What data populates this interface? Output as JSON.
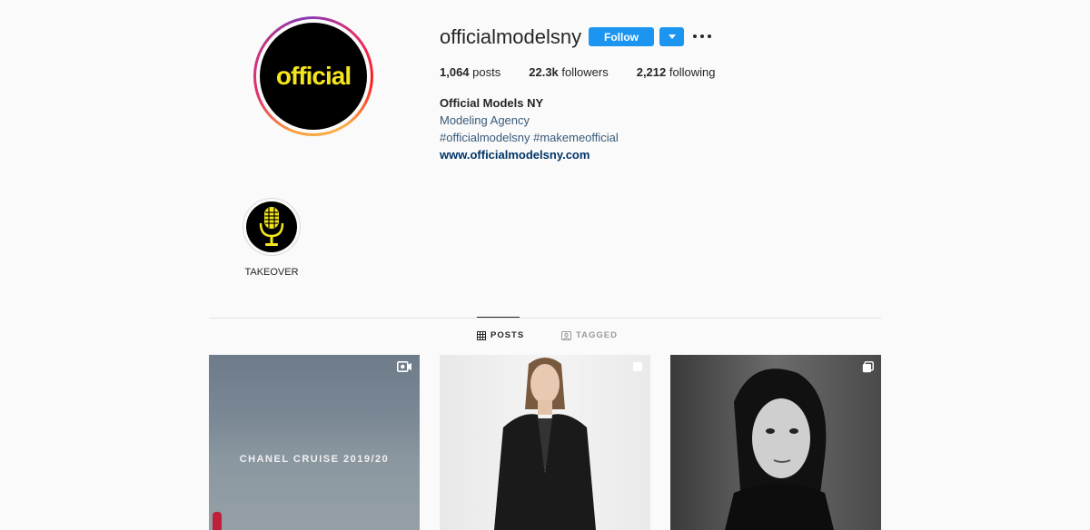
{
  "profile": {
    "username": "officialmodelsny",
    "avatar_text": "official",
    "follow_label": "Follow",
    "stats": [
      {
        "value": "1,064",
        "label": "posts"
      },
      {
        "value": "22.3k",
        "label": "followers"
      },
      {
        "value": "2,212",
        "label": "following"
      }
    ],
    "bio": {
      "name": "Official Models NY",
      "category": "Modeling Agency",
      "hashtags": "#officialmodelsny #makemeofficial",
      "website": "www.officialmodelsny.com"
    }
  },
  "highlights": [
    {
      "label": "TAKEOVER",
      "icon": "microphone-icon"
    }
  ],
  "tabs": [
    {
      "label": "POSTS",
      "icon": "grid-icon",
      "active": true
    },
    {
      "label": "TAGGED",
      "icon": "tagged-icon",
      "active": false
    }
  ],
  "posts": [
    {
      "caption": "CHANEL CRUISE 2019/20",
      "badge": "igtv-icon"
    },
    {
      "caption": "",
      "badge": "multi-image-icon"
    },
    {
      "caption": "",
      "badge": "multi-image-icon"
    }
  ],
  "colors": {
    "follow_button": "#1b95f0",
    "link": "#385a7a",
    "avatar_logo": "#f5e61c"
  }
}
